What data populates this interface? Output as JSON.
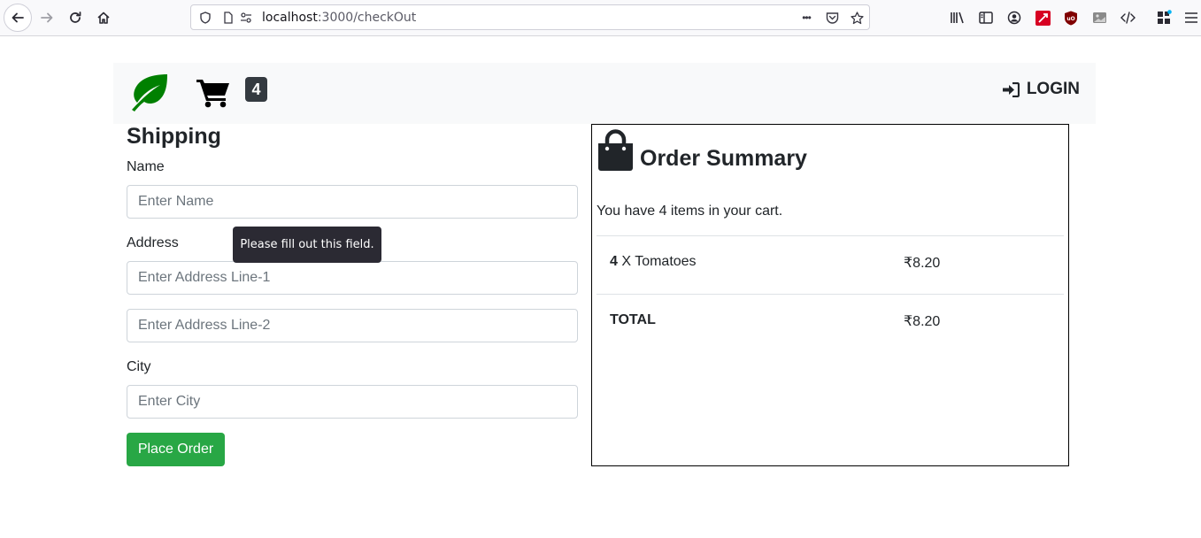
{
  "browser": {
    "url_host": "localhost",
    "url_path": ":3000/checkOut",
    "menu_dots": "•••"
  },
  "navbar": {
    "cart_count": "4",
    "login_label": "LOGIN",
    "brand_color": "#008000"
  },
  "shipping": {
    "title": "Shipping",
    "name_label": "Name",
    "name_placeholder": "Enter Name",
    "address_label": "Address",
    "address1_placeholder": "Enter Address Line-1",
    "address2_placeholder": "Enter Address Line-2",
    "city_label": "City",
    "city_placeholder": "Enter City",
    "submit_label": "Place Order",
    "submit_color": "#28a745",
    "validation_tooltip": "Please fill out this field."
  },
  "summary": {
    "title": "Order Summary",
    "count_text": "You have 4 items in your cart.",
    "items": [
      {
        "qty": "4",
        "qty_sep": " X ",
        "name": "Tomatoes",
        "price": "₹8.20"
      }
    ],
    "total_label": "TOTAL",
    "total_value": "₹8.20"
  }
}
